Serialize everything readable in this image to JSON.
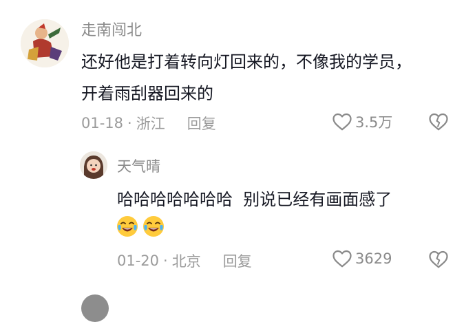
{
  "comments": [
    {
      "username": "走南闯北",
      "text_line1": "还好他是打着转向灯回来的，不像我的学员，",
      "text_line2": "开着雨刮器回来的",
      "date": "01-18",
      "location": "浙江",
      "reply_label": "回复",
      "like_count": "3.5万",
      "avatar_icon": "cartoon-figure-avatar"
    },
    {
      "username": "天气晴",
      "text": "哈哈哈哈哈哈哈  别说已经有画面感了",
      "emojis": [
        "crying-laughing-emoji-icon",
        "crying-laughing-emoji-icon"
      ],
      "date": "01-20",
      "location": "北京",
      "reply_label": "回复",
      "like_count": "3629",
      "avatar_icon": "girl-avatar"
    }
  ],
  "colors": {
    "text": "#161823",
    "meta": "#9b9b9b",
    "username": "#8a8a8a"
  }
}
